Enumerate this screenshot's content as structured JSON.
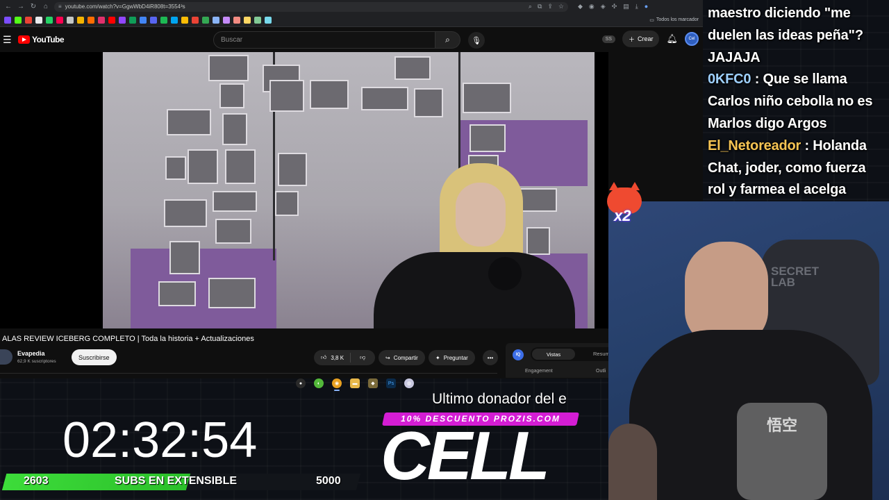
{
  "browser": {
    "url": "youtube.com/watch?v=GgwWbD4iR808t=3554³s",
    "bookmarks_all_label": "Todos los marcador"
  },
  "header": {
    "logo_text": "YouTube",
    "search_placeholder": "Buscar",
    "ss_badge": "SS",
    "create_label": "Crear",
    "avatar_text": "Cel"
  },
  "video": {
    "title": "ALAS REVIEW ICEBERG COMPLETO | Toda la historia + Actualizaciones",
    "channel_name": "Evapedia",
    "channel_subs": "62,9 K suscriptores",
    "subscribe_label": "Suscribirse",
    "likes": "3,8 K",
    "share_label": "Compartir",
    "ask_label": "Preguntar",
    "more_label": "•••"
  },
  "analytics": {
    "logo": "IQ",
    "tab_active": "Vistas",
    "tab_2": "Resum",
    "engagement_label": "Engagement",
    "outline_label": "Outli"
  },
  "chat": {
    "messages": [
      {
        "user": "",
        "user_color": "#ffffff",
        "text": "maestro diciendo \"me duelen las ideas peña\"? JAJAJA"
      },
      {
        "user": "0KFC0",
        "user_color": "#9ed0ff",
        "text": "Que se llama Carlos niño cebolla no es Marlos digo Argos"
      },
      {
        "user": "El_Netoreador",
        "user_color": "#f6c453",
        "text": "Holanda Chat, joder, como fuerza rol y farmea el acelga"
      }
    ]
  },
  "overlay": {
    "timer": "02:32:54",
    "subs_current": "2603",
    "subs_label": "SUBS EN EXTENSIBLE",
    "subs_goal": "5000",
    "subs_progress": 0.52,
    "donor_heading": "Ultimo donador del e",
    "promo_text": "10% DESCUENTO PROZIS.COM",
    "donor_name": "CELL",
    "cat_multiplier": "x2"
  },
  "webcam": {
    "chair_logo": "SECRET\nLAB",
    "shirt_kanji": "悟空"
  },
  "colors": {
    "yt_red": "#ff0000",
    "subs_green": "#3ddc3a",
    "promo_magenta": "#d41dd4",
    "chat_user_blue": "#9ed0ff",
    "chat_user_gold": "#f6c453"
  }
}
